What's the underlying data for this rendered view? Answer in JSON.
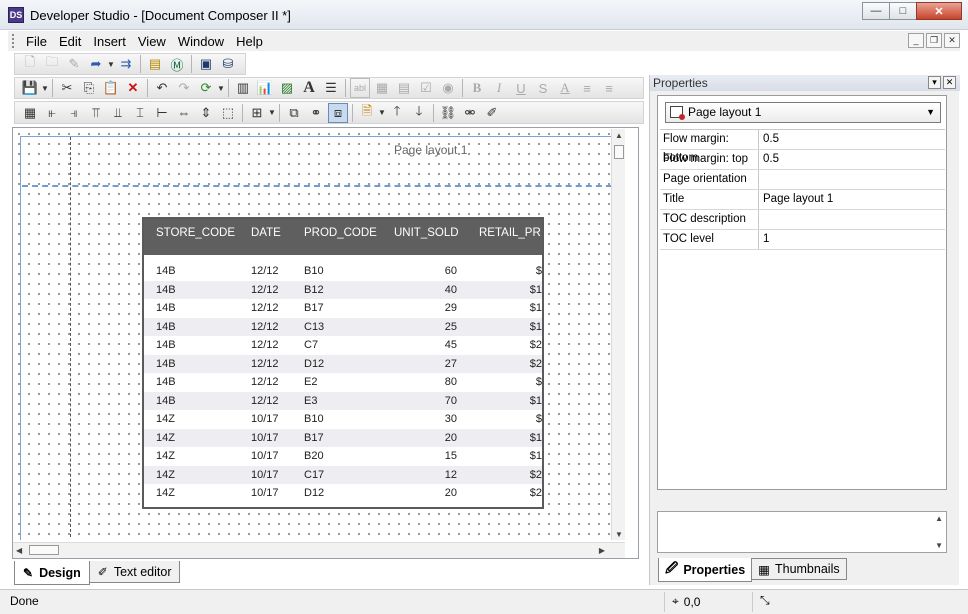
{
  "window": {
    "title": "Developer Studio - [Document Composer II *]",
    "app_icon_text": "DS",
    "minimize": "—",
    "maximize": "□",
    "close": "✕"
  },
  "menu": [
    "File",
    "Edit",
    "Insert",
    "View",
    "Window",
    "Help"
  ],
  "toolbar_text": {
    "bold": "B",
    "italic": "I",
    "underline": "U",
    "strike": "S",
    "font_color": "A",
    "big_a": "A",
    "field": "abl"
  },
  "canvas": {
    "page_label": "Page layout 1",
    "columns": [
      "STORE_CODE",
      "DATE",
      "PROD_CODE",
      "UNIT_SOLD",
      "RETAIL_PR"
    ],
    "rows": [
      [
        "14B",
        "12/12",
        "B10",
        "60",
        "$"
      ],
      [
        "14B",
        "12/12",
        "B12",
        "40",
        "$1"
      ],
      [
        "14B",
        "12/12",
        "B17",
        "29",
        "$1"
      ],
      [
        "14B",
        "12/12",
        "C13",
        "25",
        "$1"
      ],
      [
        "14B",
        "12/12",
        "C7",
        "45",
        "$2"
      ],
      [
        "14B",
        "12/12",
        "D12",
        "27",
        "$2"
      ],
      [
        "14B",
        "12/12",
        "E2",
        "80",
        "$"
      ],
      [
        "14B",
        "12/12",
        "E3",
        "70",
        "$1"
      ],
      [
        "14Z",
        "10/17",
        "B10",
        "30",
        "$"
      ],
      [
        "14Z",
        "10/17",
        "B17",
        "20",
        "$1"
      ],
      [
        "14Z",
        "10/17",
        "B20",
        "15",
        "$1"
      ],
      [
        "14Z",
        "10/17",
        "C17",
        "12",
        "$2"
      ],
      [
        "14Z",
        "10/17",
        "D12",
        "20",
        "$2"
      ]
    ]
  },
  "bottom_tabs": {
    "design": "Design",
    "text_editor": "Text editor"
  },
  "properties": {
    "header": "Properties",
    "selected": "Page layout 1",
    "grid": [
      {
        "name": "Flow margin: bottom",
        "value": "0.5"
      },
      {
        "name": "Flow margin: top",
        "value": "0.5"
      },
      {
        "name": "Page orientation",
        "value": ""
      },
      {
        "name": "Title",
        "value": "Page layout 1"
      },
      {
        "name": "TOC description",
        "value": ""
      },
      {
        "name": "TOC level",
        "value": "1"
      }
    ],
    "tabs": {
      "properties": "Properties",
      "thumbnails": "Thumbnails"
    }
  },
  "status": {
    "text": "Done",
    "coords": "0,0"
  },
  "colors": {
    "table_header": "#5f5f5f",
    "guide_blue": "#6f9bd6",
    "close_red": "#c9442c"
  }
}
